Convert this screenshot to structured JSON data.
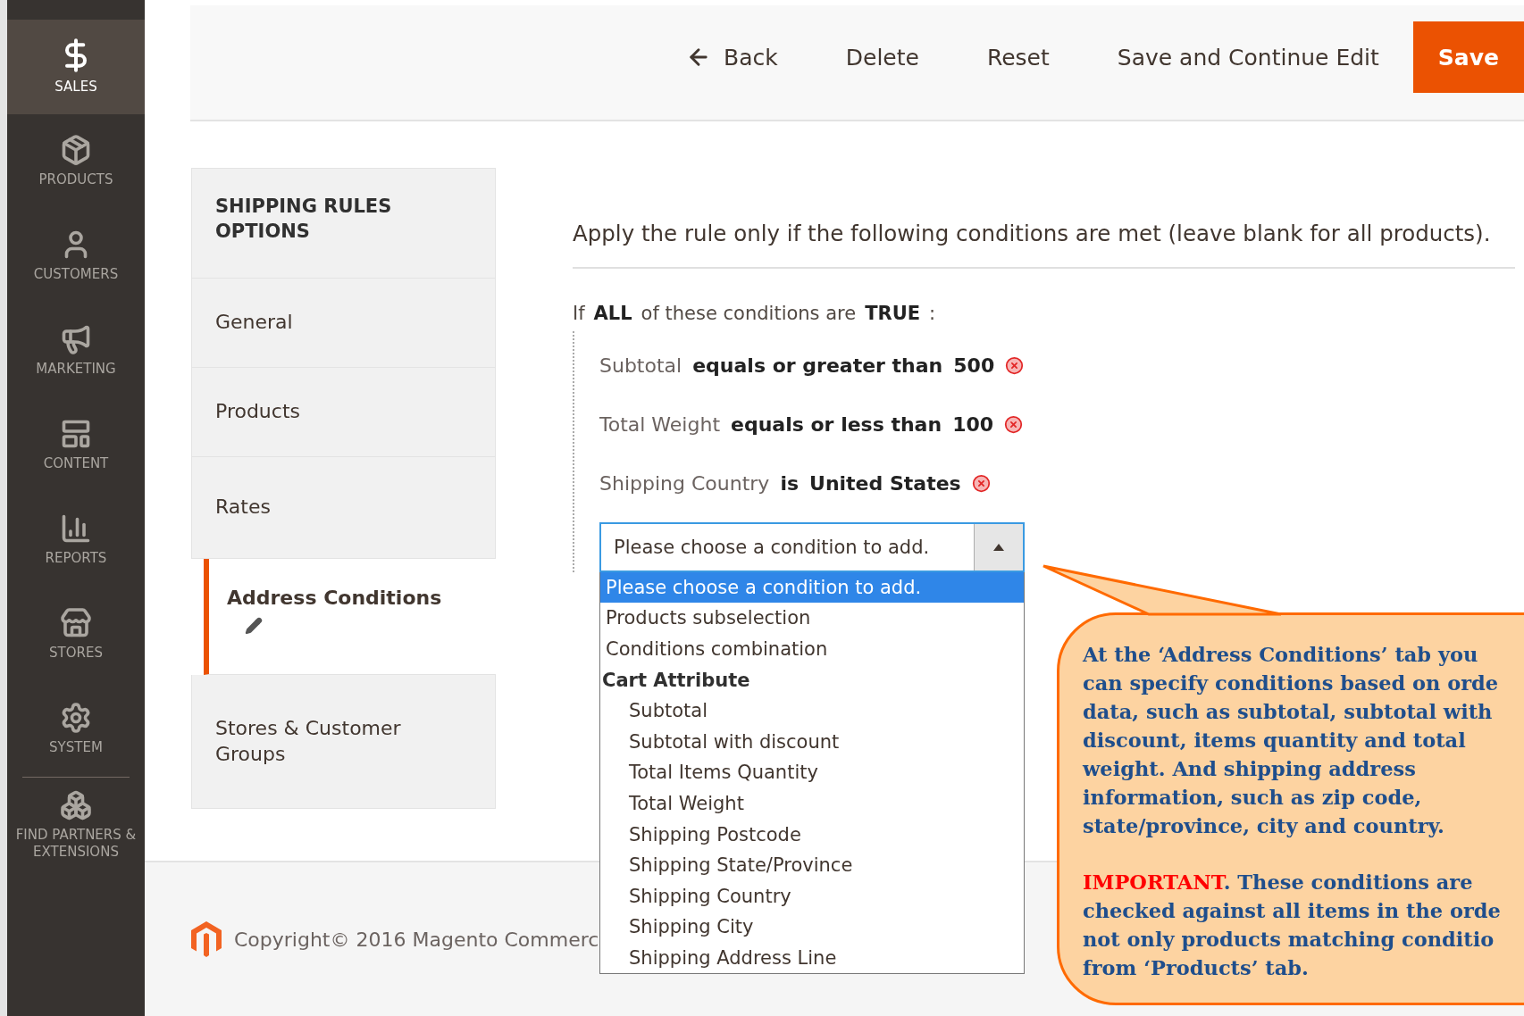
{
  "sidebar": {
    "items": [
      {
        "label": "SALES",
        "selected": true
      },
      {
        "label": "PRODUCTS",
        "selected": false
      },
      {
        "label": "CUSTOMERS",
        "selected": false
      },
      {
        "label": "MARKETING",
        "selected": false
      },
      {
        "label": "CONTENT",
        "selected": false
      },
      {
        "label": "REPORTS",
        "selected": false
      },
      {
        "label": "STORES",
        "selected": false
      },
      {
        "label": "SYSTEM",
        "selected": false
      },
      {
        "label": "FIND PARTNERS & EXTENSIONS",
        "selected": false
      }
    ]
  },
  "toolbar": {
    "buttons": [
      {
        "label": "Back",
        "kind": "back"
      },
      {
        "label": "Delete",
        "kind": "plain"
      },
      {
        "label": "Reset",
        "kind": "plain"
      },
      {
        "label": "Save and Continue Edit",
        "kind": "plain"
      },
      {
        "label": "Save",
        "kind": "primary"
      }
    ]
  },
  "tabs": {
    "title": "SHIPPING RULES OPTIONS",
    "items": [
      {
        "label": "General",
        "selected": false,
        "edited": false
      },
      {
        "label": "Products",
        "selected": false,
        "edited": false
      },
      {
        "label": "Rates",
        "selected": false,
        "edited": false
      },
      {
        "label": "Address Conditions",
        "selected": true,
        "edited": true
      },
      {
        "label": "Stores & Customer Groups",
        "selected": false,
        "edited": false
      }
    ]
  },
  "conditions": {
    "heading": "Apply the rule only if the following conditions are met (leave blank for all products).",
    "rule": [
      {
        "text": "If",
        "kind": "plain"
      },
      {
        "text": "ALL",
        "kind": "value"
      },
      {
        "text": "of these conditions are",
        "kind": "plain"
      },
      {
        "text": "TRUE",
        "kind": "value"
      },
      {
        "text": ":",
        "kind": "plain"
      }
    ],
    "items": [
      {
        "attribute": "Subtotal",
        "operator": "equals or greater than",
        "value": "500"
      },
      {
        "attribute": "Total Weight",
        "operator": "equals or less than",
        "value": "100"
      },
      {
        "attribute": "Shipping Country",
        "operator": "is",
        "value": "United States"
      }
    ],
    "select": {
      "value": "Please choose a condition to add.",
      "expanded": true,
      "options": [
        {
          "label": "Please choose a condition to add.",
          "kind": "option",
          "selected": true
        },
        {
          "label": "Products subselection",
          "kind": "option",
          "selected": false
        },
        {
          "label": "Conditions combination",
          "kind": "option",
          "selected": false
        },
        {
          "label": "Cart Attribute",
          "kind": "group",
          "children": [
            {
              "label": "Subtotal",
              "kind": "option",
              "selected": false
            },
            {
              "label": "Subtotal with discount",
              "kind": "option",
              "selected": false
            },
            {
              "label": "Total Items Quantity",
              "kind": "option",
              "selected": false
            },
            {
              "label": "Total Weight",
              "kind": "option",
              "selected": false
            },
            {
              "label": "Shipping Postcode",
              "kind": "option",
              "selected": false
            },
            {
              "label": "Shipping State/Province",
              "kind": "option",
              "selected": false
            },
            {
              "label": "Shipping Country",
              "kind": "option",
              "selected": false
            },
            {
              "label": "Shipping City",
              "kind": "option",
              "selected": false
            },
            {
              "label": "Shipping Address Line",
              "kind": "option",
              "selected": false
            }
          ]
        }
      ]
    }
  },
  "footer": {
    "copyright": "Copyright© 2016 Magento Commerc"
  },
  "callout": {
    "paragraphs": [
      {
        "lines": [
          "At the ‘Address Conditions’ tab you",
          "can specify conditions based on orde",
          "data, such as subtotal, subtotal with",
          "discount, items quantity and total",
          "weight. And shipping address",
          "information, such as zip code,",
          "state/province, city and country."
        ]
      },
      {
        "highlight": "IMPORTANT",
        "lines": [
          ". These conditions are",
          "checked against all items in the orde",
          "not only products matching conditio",
          "from ‘Products’ tab."
        ]
      }
    ]
  }
}
